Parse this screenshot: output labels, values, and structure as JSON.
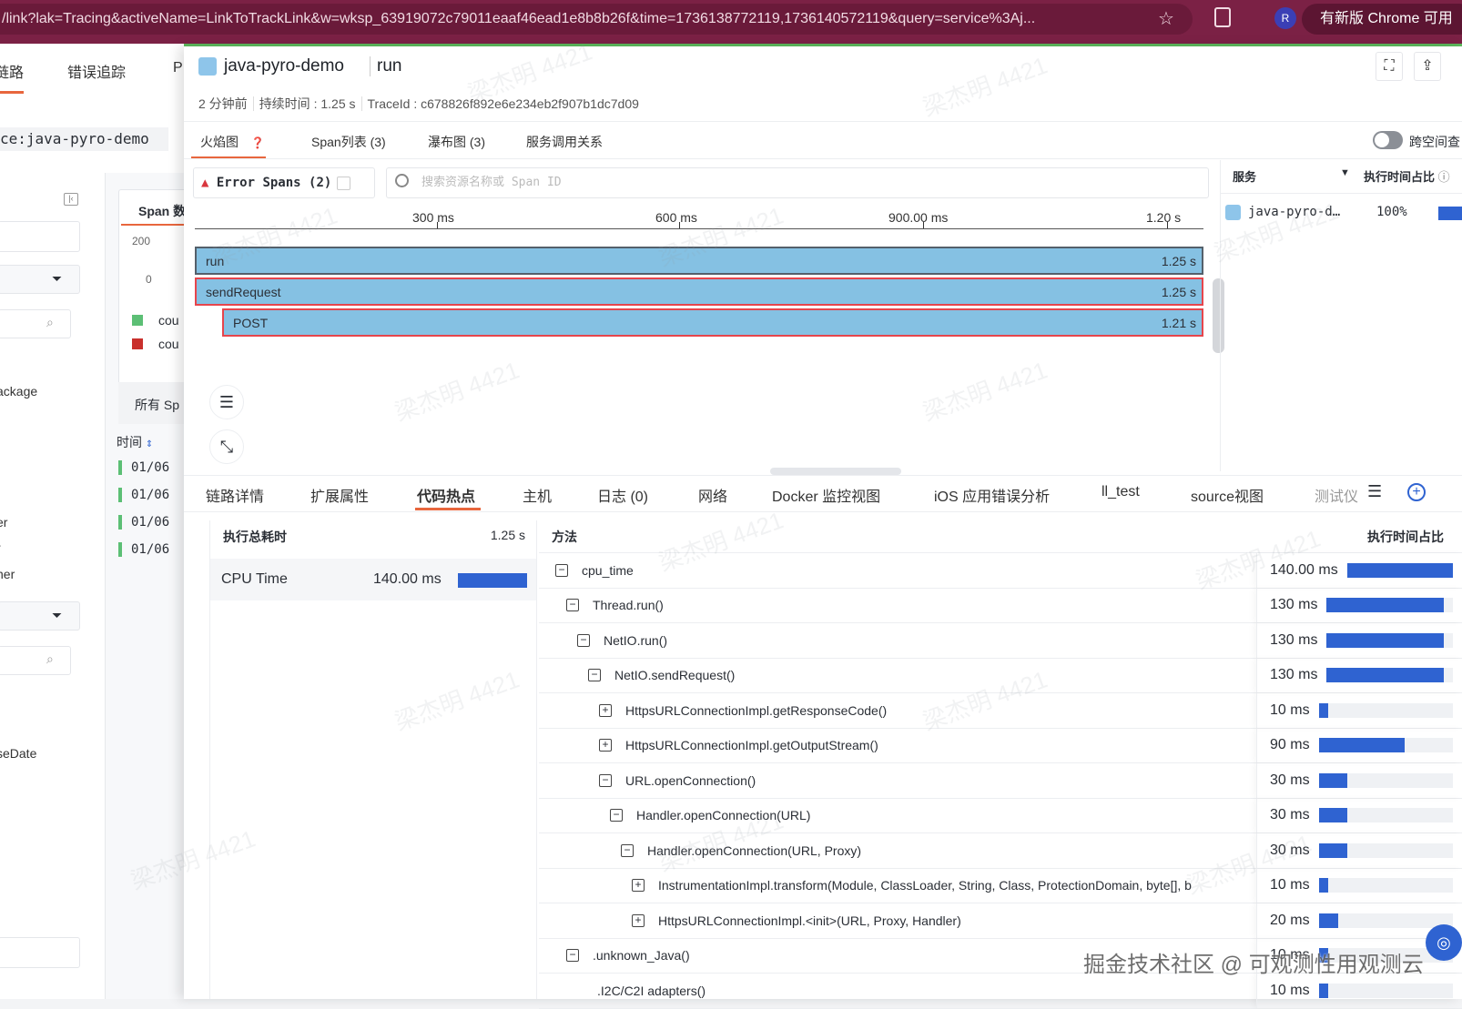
{
  "browser": {
    "url": "/link?lak=Tracing&activeName=LinkToTrackLink&w=wksp_63919072c79011eaaf46ead1e8b8b26f&time=1736138772119,1736140572119&query=service%3Aj...",
    "avatar": "R",
    "update_label": "有新版 Chrome 可用"
  },
  "left_app": {
    "nav": [
      "链路",
      "错误追踪",
      "P"
    ],
    "service_filter": "ce:java-pyro-demo",
    "fields": [
      "ackage",
      "er",
      "r",
      "ner",
      "seDate"
    ],
    "chart": {
      "tab": "Span 数",
      "y_ticks": [
        "200",
        "0"
      ],
      "legend": [
        "cou",
        "cou"
      ],
      "legend_colors": [
        "#5cbf75",
        "#c9302c"
      ]
    },
    "all_spans": "所有 Sp",
    "time_col": "时间",
    "rows": [
      "01/06",
      "01/06",
      "01/06",
      "01/06"
    ]
  },
  "header": {
    "service": "java-pyro-demo",
    "operation": "run",
    "meta": [
      "2 分钟前",
      "持续时间 : 1.25 s",
      "TraceId : c678826f892e6e234eb2f907b1dc7d09"
    ]
  },
  "tabs": [
    "火焰图",
    "Span列表 (3)",
    "瀑布图 (3)",
    "服务调用关系"
  ],
  "cross_space_label": "跨空间查",
  "error_spans": "Error Spans (2)",
  "search_placeholder": "搜索资源名称或 Span ID",
  "flame": {
    "ticks": [
      "300 ms",
      "600 ms",
      "900.00 ms",
      "1.20 s"
    ],
    "spans": [
      {
        "name": "run",
        "duration": "1.25 s",
        "error": false
      },
      {
        "name": "sendRequest",
        "duration": "1.25 s",
        "error": true
      },
      {
        "name": "POST",
        "duration": "1.21 s",
        "error": true
      }
    ]
  },
  "service_panel": {
    "col_service": "服务",
    "col_ratio": "执行时间占比",
    "rows": [
      {
        "service": "java-pyro-d…",
        "ratio": "100%",
        "fraction": 1.0
      }
    ]
  },
  "bottom_tabs": [
    "链路详情",
    "扩展属性",
    "代码热点",
    "主机",
    "日志 (0)",
    "网络",
    "Docker 监控视图",
    "iOS 应用错误分析",
    "ll_test",
    "source视图",
    "测试仪"
  ],
  "summary": {
    "title": "执行总耗时",
    "total": "1.25 s",
    "label": "CPU Time",
    "value": "140.00 ms",
    "fraction": 1.0
  },
  "hotspots": {
    "col_method": "方法",
    "col_ratio": "执行时间占比",
    "rows": [
      {
        "method": "cpu_time",
        "value": "140.00 ms",
        "ms": 140,
        "level": 0,
        "toggle": "−"
      },
      {
        "method": "Thread.run()",
        "value": "130 ms",
        "ms": 130,
        "level": 1,
        "toggle": "−"
      },
      {
        "method": "NetIO.run()",
        "value": "130 ms",
        "ms": 130,
        "level": 2,
        "toggle": "−"
      },
      {
        "method": "NetIO.sendRequest()",
        "value": "130 ms",
        "ms": 130,
        "level": 3,
        "toggle": "−"
      },
      {
        "method": "HttpsURLConnectionImpl.getResponseCode()",
        "value": "10 ms",
        "ms": 10,
        "level": 4,
        "toggle": "+"
      },
      {
        "method": "HttpsURLConnectionImpl.getOutputStream()",
        "value": "90 ms",
        "ms": 90,
        "level": 4,
        "toggle": "+"
      },
      {
        "method": "URL.openConnection()",
        "value": "30 ms",
        "ms": 30,
        "level": 4,
        "toggle": "−"
      },
      {
        "method": "Handler.openConnection(URL)",
        "value": "30 ms",
        "ms": 30,
        "level": 5,
        "toggle": "−"
      },
      {
        "method": "Handler.openConnection(URL, Proxy)",
        "value": "30 ms",
        "ms": 30,
        "level": 6,
        "toggle": "−"
      },
      {
        "method": "InstrumentationImpl.transform(Module, ClassLoader, String, Class, ProtectionDomain, byte[], b",
        "value": "10 ms",
        "ms": 10,
        "level": 7,
        "toggle": "+"
      },
      {
        "method": "HttpsURLConnectionImpl.<init>(URL, Proxy, Handler)",
        "value": "20 ms",
        "ms": 20,
        "level": 7,
        "toggle": "+"
      },
      {
        "method": ".unknown_Java()",
        "value": "10 ms",
        "ms": 10,
        "level": 1,
        "toggle": "−"
      },
      {
        "method": ".I2C/C2I adapters()",
        "value": "10 ms",
        "ms": 10,
        "level": 2,
        "toggle": ""
      }
    ]
  },
  "watermark": "梁杰明 4421",
  "footer_watermark": "掘金技术社区 @ 可观测性用观测云"
}
